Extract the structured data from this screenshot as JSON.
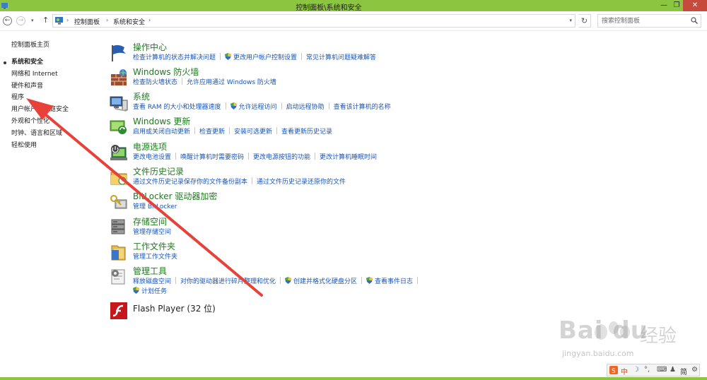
{
  "window": {
    "title": "控制面板\\系统和安全",
    "min_label": "—",
    "max_label": "❐",
    "close_label": "✕"
  },
  "nav": {
    "back": "←",
    "forward": "→",
    "dropdown": "▾",
    "up": "↑",
    "refresh": "↻",
    "breadcrumb": [
      "控制面板",
      "系统和安全"
    ],
    "breadcrumb_sep": "›",
    "search_placeholder": "搜索控制面板"
  },
  "sidebar": {
    "home": "控制面板主页",
    "items": [
      {
        "label": "系统和安全",
        "current": true
      },
      {
        "label": "网络和 Internet"
      },
      {
        "label": "硬件和声音"
      },
      {
        "label": "程序"
      },
      {
        "label": "用户帐户和家庭安全"
      },
      {
        "label": "外观和个性化"
      },
      {
        "label": "时钟、语言和区域"
      },
      {
        "label": "轻松使用"
      }
    ]
  },
  "categories": [
    {
      "title": "操作中心",
      "icon": "action-center-flag-icon",
      "links": [
        "检查计算机的状态并解决问题",
        "更改用户帐户控制设置",
        "常见计算机问题疑难解答"
      ]
    },
    {
      "title": "Windows 防火墙",
      "icon": "firewall-icon",
      "links": [
        "检查防火墙状态",
        "允许应用通过 Windows 防火墙"
      ]
    },
    {
      "title": "系统",
      "icon": "system-computer-icon",
      "links": [
        "查看 RAM 的大小和处理器速度",
        "允许远程访问",
        "启动远程协助",
        "查看该计算机的名称"
      ]
    },
    {
      "title": "Windows 更新",
      "icon": "windows-update-icon",
      "links": [
        "启用或关闭自动更新",
        "检查更新",
        "安装可选更新",
        "查看更新历史记录"
      ]
    },
    {
      "title": "电源选项",
      "icon": "power-options-icon",
      "links": [
        "更改电池设置",
        "唤醒计算机时需要密码",
        "更改电源按钮的功能",
        "更改计算机睡眠时间"
      ]
    },
    {
      "title": "文件历史记录",
      "icon": "file-history-icon",
      "links": [
        "通过文件历史记录保存你的文件备份副本",
        "通过文件历史记录还原你的文件"
      ]
    },
    {
      "title": "BitLocker 驱动器加密",
      "icon": "bitlocker-key-icon",
      "links": [
        "管理 BitLocker"
      ]
    },
    {
      "title": "存储空间",
      "icon": "storage-spaces-icon",
      "links": [
        "管理存储空间"
      ]
    },
    {
      "title": "工作文件夹",
      "icon": "work-folders-icon",
      "links": [
        "管理工作文件夹"
      ]
    },
    {
      "title": "管理工具",
      "icon": "admin-tools-icon",
      "links": [
        "释放磁盘空间",
        "对你的驱动器进行碎片整理和优化",
        "创建并格式化硬盘分区",
        "查看事件日志"
      ],
      "links2": [
        "计划任务"
      ]
    },
    {
      "title": "Flash Player (32 位)",
      "icon": "flash-player-icon",
      "links": []
    }
  ],
  "watermark": {
    "brand": "Bai du",
    "cn": "经验",
    "url": "jingyan.baidu.com"
  },
  "ime": {
    "items": [
      "中",
      "☽",
      "°,",
      "⌨",
      "♟",
      "简",
      "⚙"
    ]
  },
  "colors": {
    "titlebar": "#8cc53f",
    "category_title": "#1e7c1e",
    "link": "#1a55b5",
    "arrow": "#e8413a"
  }
}
